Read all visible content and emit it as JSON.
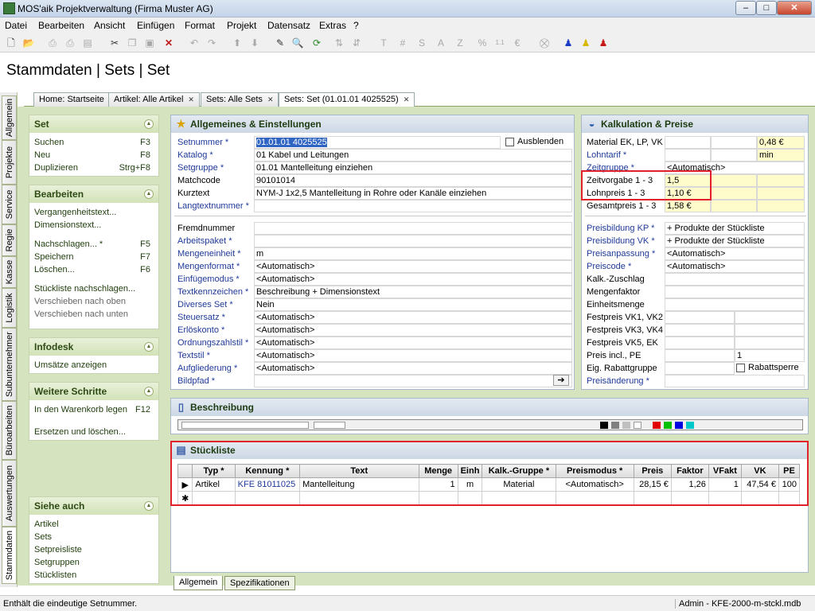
{
  "window": {
    "title": "MOS'aik Projektverwaltung (Firma Muster AG)",
    "minimize": "–",
    "maximize": "□",
    "close": "✕"
  },
  "menu": [
    "Datei",
    "Bearbeiten",
    "Ansicht",
    "Einfügen",
    "Format",
    "Projekt",
    "Datensatz",
    "Extras",
    "?"
  ],
  "toolbar_icons": [
    "new-icon",
    "open-icon",
    "print-icon",
    "print-preview-icon",
    "paste-special-icon",
    "cut-icon",
    "copy-icon",
    "paste-icon",
    "delete-icon",
    "undo-icon",
    "redo-icon",
    "move-up-icon",
    "move-down-icon",
    "edit-icon",
    "lookup-icon",
    "refresh-icon",
    "sort-icon",
    "sort-desc-icon",
    "text-icon",
    "hash-icon",
    "s-icon",
    "a-icon",
    "z-icon",
    "percent-icon",
    "numbers-icon",
    "currency-icon",
    "hide-icon",
    "user-blue-icon",
    "user-yellow-icon",
    "user-red-icon"
  ],
  "page_title": "Stammdaten | Sets | Set",
  "doc_tabs": [
    "Home: Startseite",
    "Artikel: Alle Artikel",
    "Sets: Alle Sets",
    "Sets: Set (01.01.01 4025525)"
  ],
  "left_tabs": [
    "Allgemein",
    "Projekte",
    "Service",
    "Regie",
    "Kasse",
    "Logistik",
    "Subunternehmer",
    "Büroarbeiten",
    "Auswertungen",
    "Stammdaten"
  ],
  "side": {
    "set": {
      "title": "Set",
      "items": [
        {
          "label": "Suchen",
          "key": "F3"
        },
        {
          "label": "Neu",
          "key": "F8"
        },
        {
          "label": "Duplizieren",
          "key": "Strg+F8"
        }
      ]
    },
    "bearbeiten": {
      "title": "Bearbeiten",
      "items1": [
        {
          "label": "Vergangenheitstext..."
        },
        {
          "label": "Dimensionstext..."
        }
      ],
      "items2": [
        {
          "label": "Nachschlagen... *",
          "key": "F5"
        },
        {
          "label": "Speichern",
          "key": "F7"
        },
        {
          "label": "Löschen...",
          "key": "F6"
        }
      ],
      "items3": [
        {
          "label": "Stückliste nachschlagen..."
        },
        {
          "label": "Verschieben nach oben"
        },
        {
          "label": "Verschieben nach unten"
        }
      ]
    },
    "infodesk": {
      "title": "Infodesk",
      "items": [
        {
          "label": "Umsätze anzeigen"
        }
      ]
    },
    "weitere": {
      "title": "Weitere Schritte",
      "items": [
        {
          "label": "In den Warenkorb legen",
          "key": "F12"
        },
        {
          "label": "Ersetzen und löschen..."
        }
      ]
    },
    "siehe": {
      "title": "Siehe auch",
      "items": [
        {
          "label": "Artikel"
        },
        {
          "label": "Sets"
        },
        {
          "label": "Setpreisliste"
        },
        {
          "label": "Setgruppen"
        },
        {
          "label": "Stücklisten"
        }
      ]
    }
  },
  "allgemein": {
    "title": "Allgemeines & Einstellungen",
    "ausblenden": "Ausblenden",
    "top": [
      {
        "label": "Setnummer *",
        "value": "01.01.01 4025525",
        "link": true
      },
      {
        "label": "Katalog *",
        "value": "01 Kabel und Leitungen",
        "link": true
      },
      {
        "label": "Setgruppe *",
        "value": "01.01 Mantelleitung einziehen",
        "link": true
      },
      {
        "label": "Matchcode",
        "value": "90101014",
        "link": false
      },
      {
        "label": "Kurztext",
        "value": "NYM-J 1x2,5 Mantelleitung in Rohre oder Kanäle einziehen",
        "link": false
      },
      {
        "label": "Langtextnummer *",
        "value": "",
        "link": true
      }
    ],
    "bottom": [
      {
        "label": "Fremdnummer",
        "value": "",
        "link": false
      },
      {
        "label": "Arbeitspaket *",
        "value": "",
        "link": true
      },
      {
        "label": "Mengeneinheit *",
        "value": "m",
        "link": true
      },
      {
        "label": "Mengenformat *",
        "value": "<Automatisch>",
        "link": true
      },
      {
        "label": "Einfügemodus *",
        "value": "<Automatisch>",
        "link": true
      },
      {
        "label": "Textkennzeichen *",
        "value": "Beschreibung + Dimensionstext",
        "link": true
      },
      {
        "label": "Diverses Set *",
        "value": "Nein",
        "link": true
      },
      {
        "label": "Steuersatz *",
        "value": "<Automatisch>",
        "link": true
      },
      {
        "label": "Erlöskonto *",
        "value": "<Automatisch>",
        "link": true
      },
      {
        "label": "Ordnungszahlstil *",
        "value": "<Automatisch>",
        "link": true
      },
      {
        "label": "Textstil *",
        "value": "<Automatisch>",
        "link": true
      },
      {
        "label": "Aufgliederung *",
        "value": "<Automatisch>",
        "link": true
      },
      {
        "label": "Bildpfad *",
        "value": "",
        "link": true
      }
    ]
  },
  "kalk": {
    "title": "Kalkulation & Preise",
    "top": [
      {
        "label": "Material EK, LP, VK",
        "v4": "0,48 €",
        "link": false
      },
      {
        "label": "Lohntarif *",
        "v4": "min",
        "link": true
      },
      {
        "label": "Zeitgruppe *",
        "v2": "<Automatisch>",
        "link": true
      },
      {
        "label": "Zeitvorgabe 1 - 3",
        "v2": "1,5",
        "link": false
      },
      {
        "label": "Lohnpreis 1 - 3",
        "v2": "1,10 €",
        "link": false
      },
      {
        "label": "Gesamtpreis 1 - 3",
        "v2": "1,58 €",
        "link": false
      }
    ],
    "bottom": [
      {
        "label": "Preisbildung KP *",
        "value": "+ Produkte der Stückliste",
        "link": true
      },
      {
        "label": "Preisbildung VK *",
        "value": "+ Produkte der Stückliste",
        "link": true
      },
      {
        "label": "Preisanpassung *",
        "value": "<Automatisch>",
        "link": true
      },
      {
        "label": "Preiscode *",
        "value": "<Automatisch>",
        "link": true
      },
      {
        "label": "Kalk.-Zuschlag",
        "value": "",
        "link": false
      },
      {
        "label": "Mengenfaktor",
        "value": "",
        "link": false
      },
      {
        "label": "Einheitsmenge",
        "value": "",
        "link": false
      },
      {
        "label": "Festpreis VK1, VK2",
        "value": "",
        "link": false
      },
      {
        "label": "Festpreis VK3, VK4",
        "value": "",
        "link": false
      },
      {
        "label": "Festpreis VK5, EK",
        "value": "",
        "link": false
      },
      {
        "label": "Preis incl., PE",
        "value": "1",
        "link": false
      },
      {
        "label": "Eig. Rabattgruppe",
        "value": "Rabattsperre",
        "link": false
      },
      {
        "label": "Preisänderung *",
        "value": "",
        "link": true
      }
    ]
  },
  "beschreibung": {
    "title": "Beschreibung"
  },
  "stueckliste": {
    "title": "Stückliste",
    "columns": [
      "",
      "Typ *",
      "Kennung *",
      "Text",
      "Menge",
      "Einh",
      "Kalk.-Gruppe *",
      "Preismodus *",
      "Preis",
      "Faktor",
      "VFakt",
      "VK",
      "PE"
    ],
    "rows": [
      [
        "▶",
        "Artikel",
        "KFE 81011025",
        "Mantelleitung",
        "1",
        "m",
        "Material",
        "<Automatisch>",
        "28,15 €",
        "1,26",
        "1",
        "47,54 €",
        "100"
      ]
    ],
    "new_row_marker": "✱"
  },
  "bottom_tabs": [
    "Allgemein",
    "Spezifikationen"
  ],
  "status": {
    "left": "Enthält die eindeutige Setnummer.",
    "right": "Admin - KFE-2000-m-stckl.mdb"
  }
}
